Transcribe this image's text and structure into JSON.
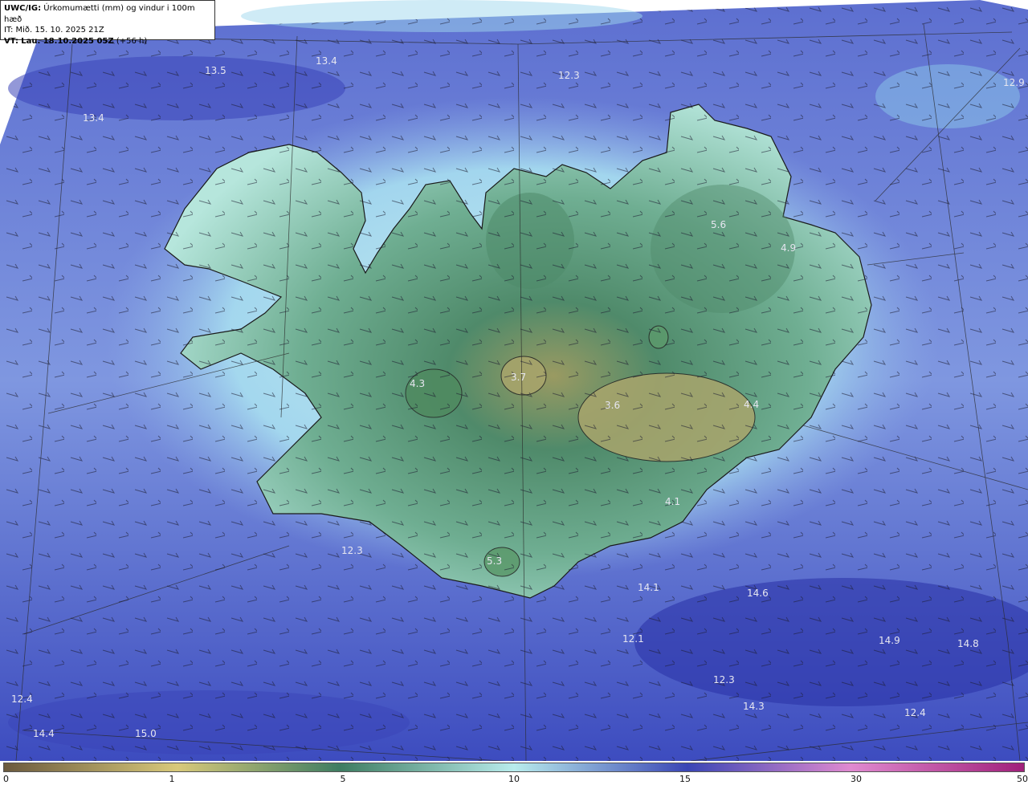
{
  "header": {
    "model_label": "UWC/IG:",
    "title": "Úrkomumætti (mm) og vindur i 100m hæð",
    "init_time": "IT: Mið. 15. 10. 2025 21Z",
    "valid_label": "VT:",
    "valid_time": "Lau. 18.10.2025 05Z",
    "valid_offset": "(+56 h)"
  },
  "map_values": [
    "13.5",
    "13.4",
    "12.3",
    "12.9",
    "13.4",
    "5.6",
    "4.9",
    "3.7",
    "4.3",
    "3.6",
    "4.4",
    "4.1",
    "5.3",
    "12.3",
    "14.1",
    "14.6",
    "12.1",
    "14.9",
    "14.8",
    "12.3",
    "14.3",
    "12.4",
    "12.4",
    "14.4",
    "15.0"
  ],
  "colorbar": {
    "ticks": [
      "0",
      "1",
      "5",
      "10",
      "15",
      "30",
      "50"
    ],
    "colors": [
      "#6b5a3e",
      "#d8c97a",
      "#3e7d62",
      "#b8ecec",
      "#3a46b5",
      "#e08ad0",
      "#a0207a"
    ]
  }
}
